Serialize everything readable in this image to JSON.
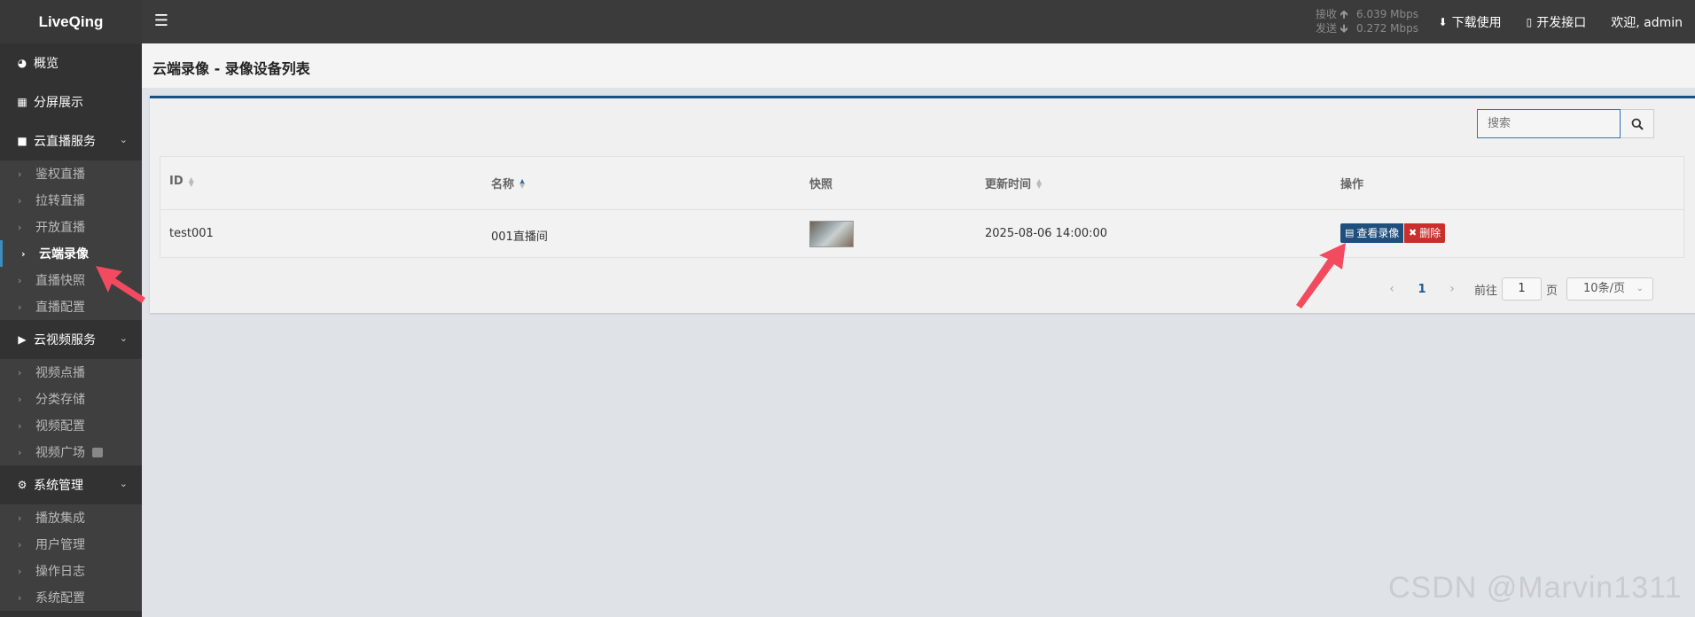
{
  "header": {
    "brand": "LiveQing",
    "net": {
      "recv_label": "接收",
      "recv_value": "6.039 Mbps",
      "send_label": "发送",
      "send_value": "0.272 Mbps"
    },
    "nav": {
      "download": "下载使用",
      "api": "开发接口",
      "welcome": "欢迎, admin"
    }
  },
  "sidebar": {
    "overview": "概览",
    "split": "分屏展示",
    "live_group": "云直播服务",
    "live_items": [
      "鉴权直播",
      "拉转直播",
      "开放直播",
      "云端录像",
      "直播快照",
      "直播配置"
    ],
    "vod_group": "云视频服务",
    "vod_items": [
      "视频点播",
      "分类存储",
      "视频配置",
      "视频广场"
    ],
    "sys_group": "系统管理",
    "sys_items": [
      "播放集成",
      "用户管理",
      "操作日志",
      "系统配置"
    ]
  },
  "page": {
    "title": "云端录像 - 录像设备列表"
  },
  "search": {
    "placeholder": "搜索"
  },
  "table": {
    "headers": {
      "id": "ID",
      "name": "名称",
      "snapshot": "快照",
      "updated": "更新时间",
      "ops": "操作"
    },
    "rows": [
      {
        "id": "test001",
        "name": "001直播间",
        "updated": "2025-08-06 14:00:00"
      }
    ],
    "view_label": "查看录像",
    "delete_label": "删除"
  },
  "pager": {
    "current": "1",
    "goto_label": "前往",
    "goto_value": "1",
    "page_suffix": "页",
    "page_size": "10条/页"
  },
  "watermark": "CSDN @Marvin1311",
  "colors": {
    "primary": "#1f4f7d",
    "danger": "#c9302c",
    "annotation": "#f24a5e"
  }
}
